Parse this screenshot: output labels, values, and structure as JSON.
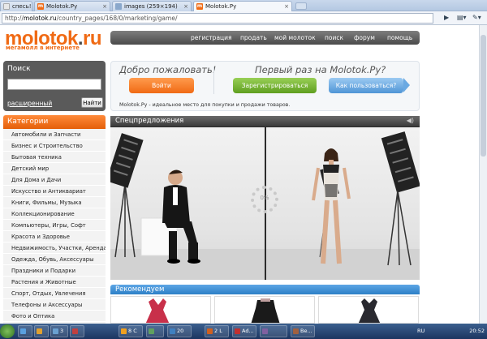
{
  "browser": {
    "tabs": [
      {
        "label": "спесь! ...",
        "favicon": "blank",
        "active": false
      },
      {
        "label": "Molotok.Ру",
        "favicon": "molotok",
        "active": false
      },
      {
        "label": "images (259×194)",
        "favicon": "image",
        "active": false
      },
      {
        "label": "Molotok.Ру",
        "favicon": "molotok",
        "active": true
      }
    ],
    "url_prefix": "http://",
    "url_domain": "molotok.ru",
    "url_path": "/country_pages/168/0/marketing/game/"
  },
  "site": {
    "logo_main": "molotok",
    "logo_dot": ".",
    "logo_tld": "ru",
    "slogan": "мегамолл в интернете",
    "brand_color": "#f06a14"
  },
  "nav": [
    "регистрация",
    "продать",
    "мой молоток",
    "поиск",
    "форум",
    "помощь"
  ],
  "search": {
    "title": "Поиск",
    "placeholder": "",
    "advanced": "расширенный",
    "button": "Найти"
  },
  "categories": {
    "title": "Категории",
    "items": [
      "Автомобили и Запчасти",
      "Бизнес и Строительство",
      "Бытовая техника",
      "Детский мир",
      "Для Дома и Дачи",
      "Искусство и Антиквариат",
      "Книги, Фильмы, Музыка",
      "Коллекционирование",
      "Компьютеры, Игры, Софт",
      "Красота и Здоровье",
      "Недвижимость, Участки, Аренда",
      "Одежда, Обувь, Аксессуары",
      "Праздники и Подарки",
      "Растения и Животные",
      "Спорт, Отдых, Увлечения",
      "Телефоны и Аксессуары",
      "Фото и Оптика"
    ]
  },
  "welcome": {
    "greeting": "Добро пожаловать!",
    "first_time": "Первый раз на Molotok.Ру?",
    "login": "Войти",
    "register": "Зарегистрироваться",
    "how_to": "Как пользоваться?",
    "description": "Molotok.Ру - идеальное место для покупки и продажи товаров."
  },
  "special": {
    "title": "Спецпредложения",
    "loading": "0%"
  },
  "recommend": {
    "title": "Рекомендуем"
  },
  "taskbar": {
    "items": [
      {
        "label": "",
        "color": "#5aa0e0"
      },
      {
        "label": "",
        "color": "#e0a030"
      },
      {
        "label": "3",
        "color": "#6aa0d0"
      },
      {
        "label": "",
        "color": "#c04040"
      },
      {
        "label": "8 С",
        "color": "#f0a020"
      },
      {
        "label": "",
        "color": "#60a060"
      },
      {
        "label": "20",
        "color": "#4080c0"
      },
      {
        "label": "2 L",
        "color": "#d06020"
      },
      {
        "label": "Ad...",
        "color": "#c03030"
      },
      {
        "label": "",
        "color": "#8060a0"
      },
      {
        "label": "Ве...",
        "color": "#a06040"
      }
    ],
    "lang": "RU",
    "clock": "20:52"
  }
}
